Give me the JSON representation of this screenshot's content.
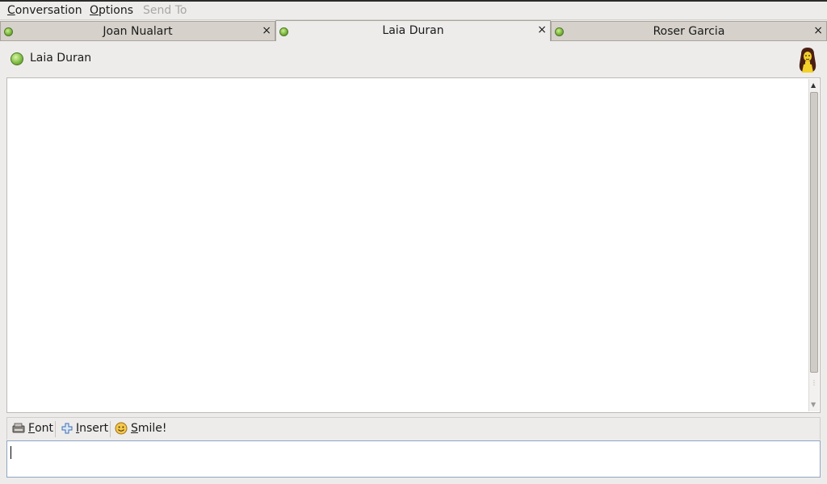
{
  "menubar": {
    "items": [
      {
        "label": "Conversation",
        "mnemonic": "C",
        "rest": "onversation",
        "enabled": true
      },
      {
        "label": "Options",
        "mnemonic": "O",
        "rest": "ptions",
        "enabled": true
      },
      {
        "label": "Send To",
        "mnemonic": "",
        "rest": "",
        "enabled": false
      }
    ]
  },
  "tabs": [
    {
      "label": "Joan Nualart",
      "active": false,
      "status": "online"
    },
    {
      "label": "Laia Duran",
      "active": true,
      "status": "online"
    },
    {
      "label": "Roser Garcia",
      "active": false,
      "status": "online"
    }
  ],
  "close_glyph": "×",
  "header": {
    "contact_name": "Laia Duran",
    "status": "online",
    "avatar_icon": "buddy-avatar-icon"
  },
  "toolbar": {
    "font": {
      "mnemonic": "F",
      "rest": "ont",
      "icon": "font-icon"
    },
    "insert": {
      "mnemonic": "I",
      "rest": "nsert",
      "icon": "insert-plus-icon"
    },
    "smile": {
      "mnemonic": "S",
      "rest": "mile!",
      "icon": "smiley-icon"
    }
  },
  "colors": {
    "online": "#6aa532",
    "accent_border": "#8fa6c2"
  }
}
